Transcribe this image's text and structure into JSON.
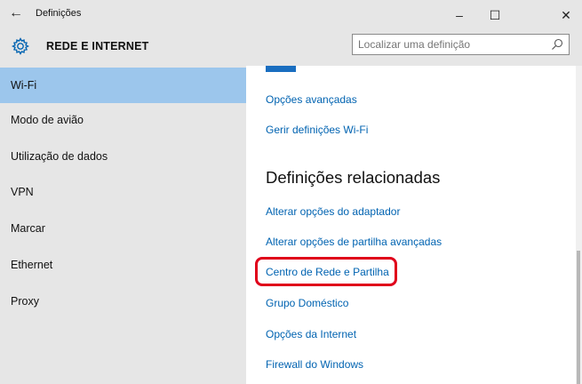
{
  "window": {
    "back_glyph": "←",
    "title": "Definições",
    "minimize_glyph": "–",
    "maximize_glyph": "☐",
    "close_glyph": "✕"
  },
  "header": {
    "icon": "gear-icon",
    "title": "REDE E INTERNET",
    "search_placeholder": "Localizar uma definição",
    "search_value": ""
  },
  "sidebar": {
    "items": [
      {
        "label": "Wi-Fi",
        "selected": true
      },
      {
        "label": "Modo de avião",
        "selected": false
      },
      {
        "label": "Utilização de dados",
        "selected": false
      },
      {
        "label": "VPN",
        "selected": false
      },
      {
        "label": "Marcar",
        "selected": false
      },
      {
        "label": "Ethernet",
        "selected": false
      },
      {
        "label": "Proxy",
        "selected": false
      }
    ]
  },
  "content": {
    "links_top": [
      "Opções avançadas",
      "Gerir definições Wi-Fi"
    ],
    "related_heading": "Definições relacionadas",
    "related_links": [
      "Alterar opções do adaptador",
      "Alterar opções de partilha avançadas",
      "Centro de Rede e Partilha",
      "Grupo Doméstico",
      "Opções da Internet",
      "Firewall do Windows"
    ],
    "highlighted_link_index": 2
  },
  "colors": {
    "accent": "#0063b1",
    "selection": "#9cc6ec",
    "chrome": "#e6e6e6",
    "highlight": "#e0001a"
  }
}
